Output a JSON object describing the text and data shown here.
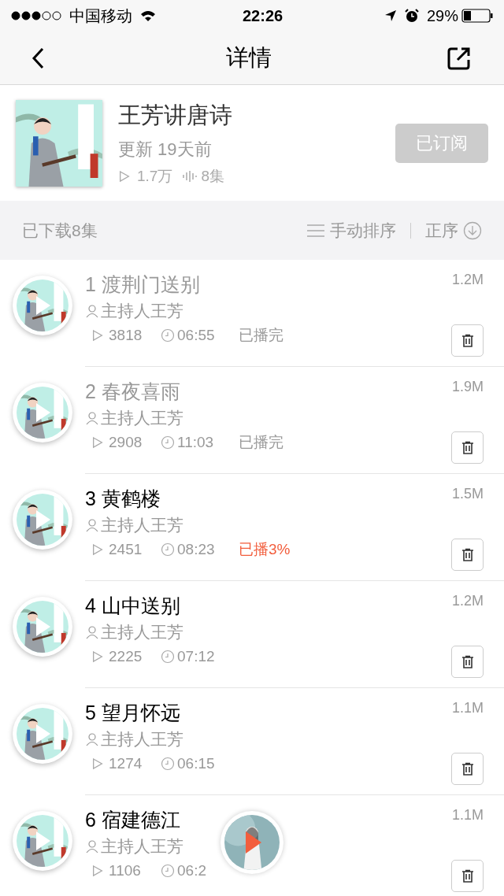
{
  "status_bar": {
    "carrier": "中国移动",
    "time": "22:26",
    "battery": "29%"
  },
  "nav": {
    "title": "详情"
  },
  "album": {
    "title": "王芳讲唐诗",
    "updated": "更新 19天前",
    "plays": "1.7万",
    "episodes": "8集",
    "subscribe": {
      "label": "已订阅",
      "subscribed": true
    }
  },
  "toolbar": {
    "downloaded": "已下载8集",
    "sort": "手动排序",
    "order": "正序"
  },
  "episodes": [
    {
      "title": "1 渡荆门送别",
      "host": "主持人王芳",
      "plays": "3818",
      "duration": "06:55",
      "progress": {
        "kind": "done",
        "text": "已播完"
      },
      "played": true,
      "size": "1.2M"
    },
    {
      "title": "2 春夜喜雨",
      "host": "主持人王芳",
      "plays": "2908",
      "duration": "11:03",
      "progress": {
        "kind": "done",
        "text": "已播完"
      },
      "played": true,
      "size": "1.9M"
    },
    {
      "title": "3 黄鹤楼",
      "host": "主持人王芳",
      "plays": "2451",
      "duration": "08:23",
      "progress": {
        "kind": "partial",
        "text": "已播3%"
      },
      "played": false,
      "size": "1.5M"
    },
    {
      "title": "4 山中送别",
      "host": "主持人王芳",
      "plays": "2225",
      "duration": "07:12",
      "played": false,
      "size": "1.2M"
    },
    {
      "title": "5 望月怀远",
      "host": "主持人王芳",
      "plays": "1274",
      "duration": "06:15",
      "played": false,
      "size": "1.1M"
    },
    {
      "title": "6 宿建德江",
      "host": "主持人王芳",
      "plays": "1106",
      "duration": "06:2",
      "played": false,
      "size": "1.1M"
    }
  ]
}
